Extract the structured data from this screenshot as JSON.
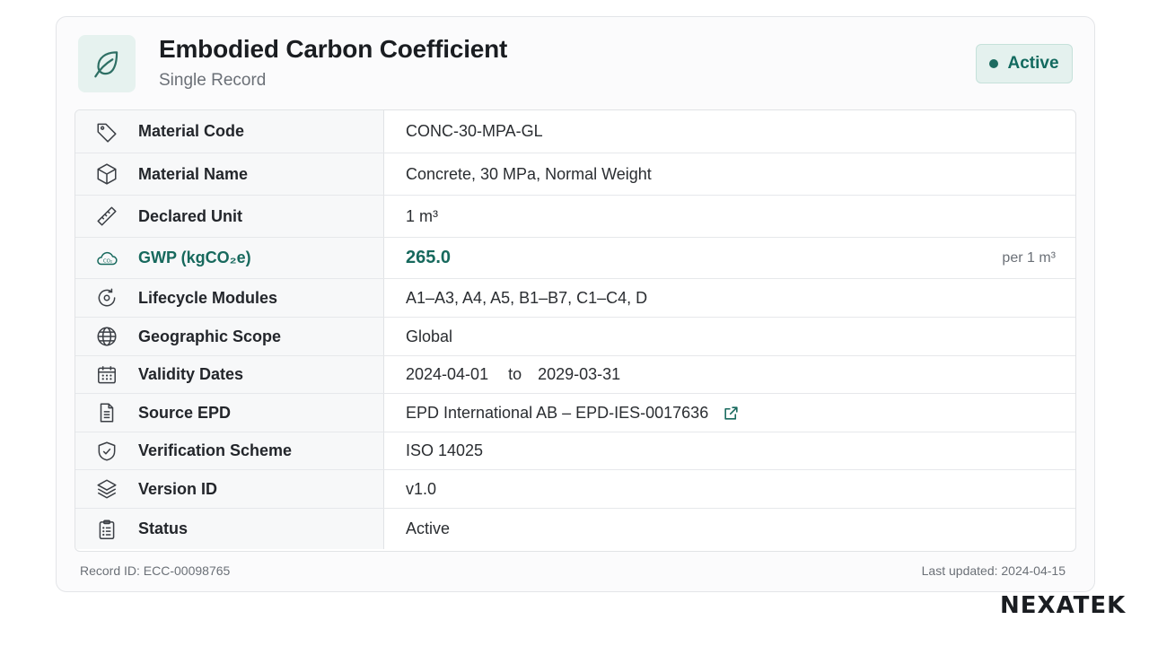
{
  "header": {
    "title": "Embodied Carbon Coefficient",
    "subtitle": "Single Record",
    "status_badge": "Active",
    "icon": "leaf-icon"
  },
  "colors": {
    "accent": "#17695d",
    "badge_bg": "#e4f1ee"
  },
  "rows": [
    {
      "icon": "tag-icon",
      "label": "Material Code",
      "value": "CONC-30-MPA-GL"
    },
    {
      "icon": "cube-icon",
      "label": "Material Name",
      "value": "Concrete, 30 MPa, Normal Weight"
    },
    {
      "icon": "ruler-icon",
      "label": "Declared Unit",
      "value": "1 m³"
    },
    {
      "icon": "co2-cloud-icon",
      "label": "GWP (kgCO₂e)",
      "value": "265.0",
      "unit": "per 1 m³"
    },
    {
      "icon": "lifecycle-icon",
      "label": "Lifecycle Modules",
      "value": "A1–A3, A4, A5, B1–B7, C1–C4, D"
    },
    {
      "icon": "globe-icon",
      "label": "Geographic Scope",
      "value": "Global"
    },
    {
      "icon": "calendar-icon",
      "label": "Validity Dates",
      "from": "2024-04-01",
      "to_word": "to",
      "to": "2029-03-31"
    },
    {
      "icon": "document-icon",
      "label": "Source EPD",
      "value": "EPD International AB – EPD-IES-0017636",
      "link_icon": "external-link-icon"
    },
    {
      "icon": "shield-check-icon",
      "label": "Verification Scheme",
      "value": "ISO 14025"
    },
    {
      "icon": "layers-icon",
      "label": "Version ID",
      "value": "v1.0"
    },
    {
      "icon": "clipboard-icon",
      "label": "Status",
      "value": "Active"
    }
  ],
  "footer": {
    "record_id": "Record ID: ECC-00098765",
    "last_updated": "Last updated: 2024-04-15"
  },
  "brand": {
    "logo_text": "NEXATEK"
  }
}
